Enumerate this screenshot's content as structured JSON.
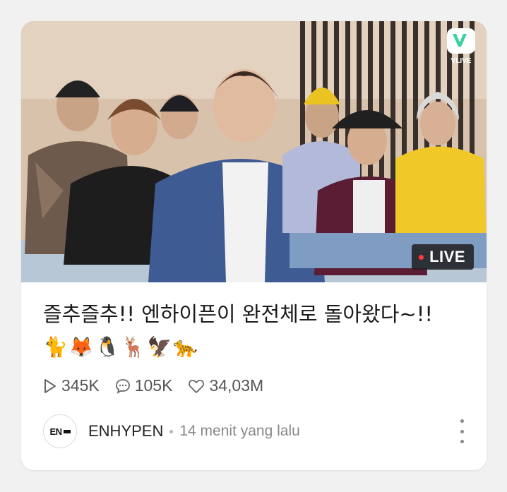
{
  "card": {
    "thumbnail": {
      "platform_label": "VLIVE",
      "live_label": "LIVE"
    },
    "title": "즐추즐추!! 엔하이픈이 완전체로 돌아왔다~!!",
    "title_emoji": "🐈🦊🐧🦌🦅🐆",
    "stats": {
      "plays": "345K",
      "comments": "105K",
      "likes": "34,03M"
    },
    "channel": {
      "avatar_text": "EN",
      "name": "ENHYPEN",
      "time": "14 menit yang lalu"
    }
  },
  "colors": {
    "vlive_green": "#37d2a0",
    "live_red": "#ff3b3b",
    "text_primary": "#1a1a1a",
    "text_secondary": "#555555"
  },
  "icons": {
    "vlive": "vlive-logo-icon",
    "play": "play-icon",
    "comment": "comment-icon",
    "like": "heart-icon",
    "more": "more-vertical-icon"
  }
}
